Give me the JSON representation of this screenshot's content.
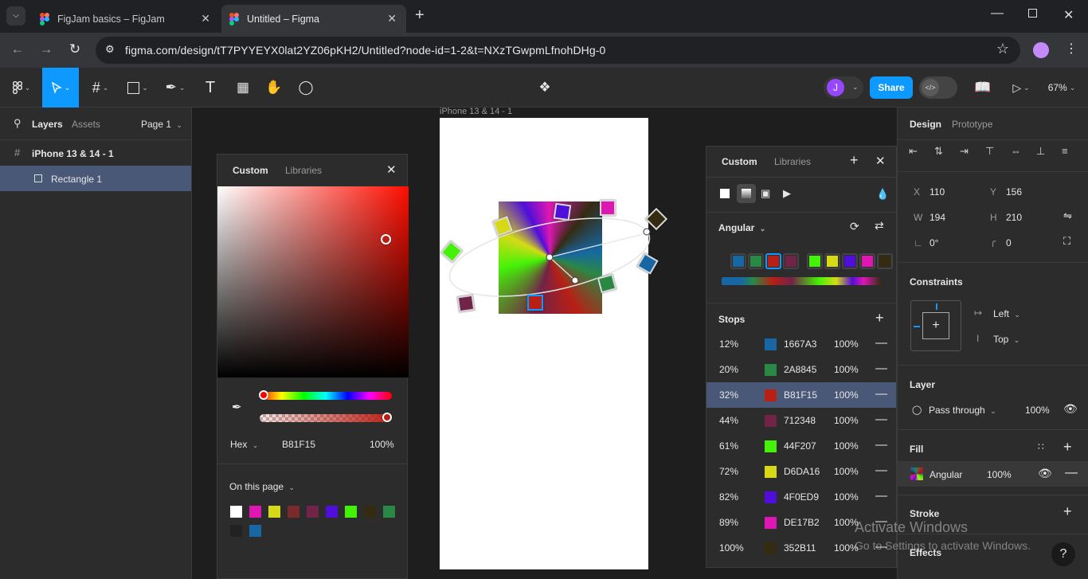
{
  "browser": {
    "tabs": [
      {
        "label": "FigJam basics – FigJam",
        "active": false
      },
      {
        "label": "Untitled – Figma",
        "active": true
      }
    ],
    "url": "figma.com/design/tT7PYYEYX0lat2YZ06pKH2/Untitled?node-id=1-2&t=NXzTGwpmLfnohDHg-0"
  },
  "toolbar": {
    "share_label": "Share",
    "zoom": "67%",
    "avatar_initial": "J"
  },
  "left_panel": {
    "tabs": [
      "Layers",
      "Assets"
    ],
    "page": "Page 1",
    "layers": [
      {
        "name": "iPhone 13 & 14 - 1",
        "type": "frame"
      },
      {
        "name": "Rectangle 1",
        "type": "rect",
        "selected": true
      }
    ]
  },
  "canvas": {
    "frame_label": "iPhone 13 & 14 - 1"
  },
  "picker": {
    "tabs": [
      "Custom",
      "Libraries"
    ],
    "hex_label": "Hex",
    "hex_value": "B81F15",
    "opacity": "100%",
    "on_this_page": "On this page",
    "page_colors": [
      "#ffffff",
      "#de17b2",
      "#d6da16",
      "#7a2a2a",
      "#712348",
      "#4f0ed9",
      "#44f207",
      "#352b11",
      "#2a8845",
      "#222222",
      "#1667a3"
    ]
  },
  "fill_popup": {
    "tabs": [
      "Custom",
      "Libraries"
    ],
    "gradient_type": "Angular",
    "stops_title": "Stops",
    "stops": [
      {
        "pos": "12%",
        "hex": "1667A3",
        "color": "#1667a3",
        "opacity": "100%",
        "selected": false
      },
      {
        "pos": "20%",
        "hex": "2A8845",
        "color": "#2a8845",
        "opacity": "100%",
        "selected": false
      },
      {
        "pos": "32%",
        "hex": "B81F15",
        "color": "#b81f15",
        "opacity": "100%",
        "selected": true
      },
      {
        "pos": "44%",
        "hex": "712348",
        "color": "#712348",
        "opacity": "100%",
        "selected": false
      },
      {
        "pos": "61%",
        "hex": "44F207",
        "color": "#44f207",
        "opacity": "100%",
        "selected": false
      },
      {
        "pos": "72%",
        "hex": "D6DA16",
        "color": "#d6da16",
        "opacity": "100%",
        "selected": false
      },
      {
        "pos": "82%",
        "hex": "4F0ED9",
        "color": "#4f0ed9",
        "opacity": "100%",
        "selected": false
      },
      {
        "pos": "89%",
        "hex": "DE17B2",
        "color": "#de17b2",
        "opacity": "100%",
        "selected": false
      },
      {
        "pos": "100%",
        "hex": "352B11",
        "color": "#352b11",
        "opacity": "100%",
        "selected": false
      }
    ]
  },
  "right_panel": {
    "tabs": [
      "Design",
      "Prototype"
    ],
    "x": "110",
    "y": "156",
    "w": "194",
    "h": "210",
    "rotation": "0°",
    "radius": "0",
    "constraints_title": "Constraints",
    "constraint_h": "Left",
    "constraint_v": "Top",
    "layer_title": "Layer",
    "blend": "Pass through",
    "layer_opacity": "100%",
    "fill_title": "Fill",
    "fill_type": "Angular",
    "fill_opacity": "100%",
    "stroke_title": "Stroke",
    "effects_title": "Effects"
  },
  "watermark": {
    "line1": "Activate Windows",
    "line2": "Go to Settings to activate Windows."
  }
}
